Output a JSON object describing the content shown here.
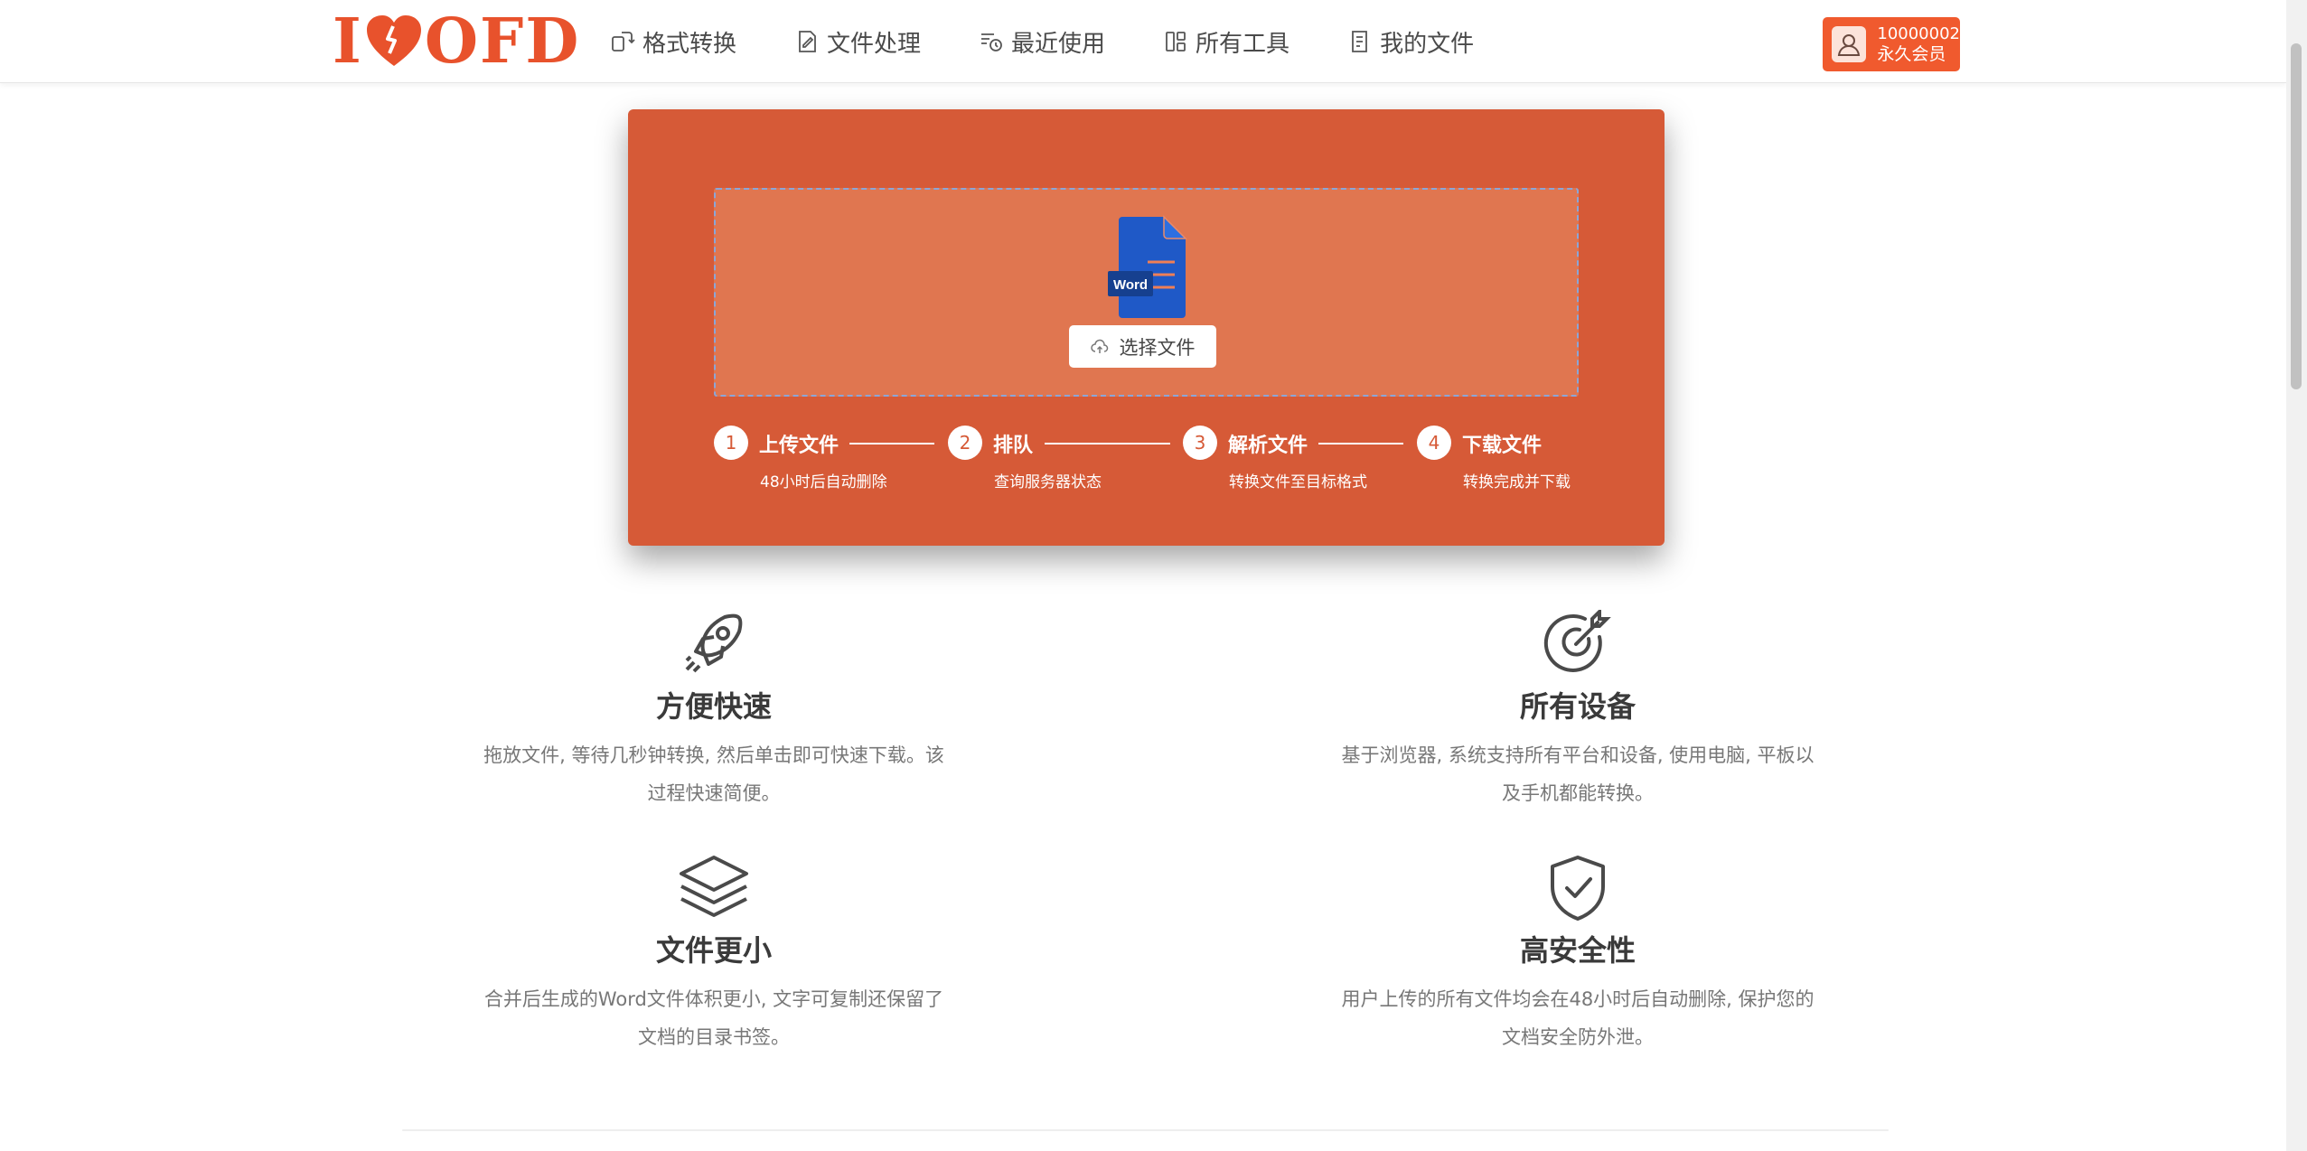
{
  "brand": {
    "logo_left": "I",
    "logo_right": "OFD",
    "accent": "#e8522c"
  },
  "nav": {
    "items": [
      {
        "label": "格式转换",
        "icon": "convert-icon"
      },
      {
        "label": "文件处理",
        "icon": "file-edit-icon"
      },
      {
        "label": "最近使用",
        "icon": "recent-icon"
      },
      {
        "label": "所有工具",
        "icon": "grid-icon"
      },
      {
        "label": "我的文件",
        "icon": "my-files-icon"
      }
    ]
  },
  "user": {
    "id": "10000002",
    "level": "永久会员"
  },
  "upload": {
    "file_type_label": "Word",
    "button_label": "选择文件",
    "steps": [
      {
        "num": "1",
        "title": "上传文件",
        "desc": "48小时后自动删除"
      },
      {
        "num": "2",
        "title": "排队",
        "desc": "查询服务器状态"
      },
      {
        "num": "3",
        "title": "解析文件",
        "desc": "转换文件至目标格式"
      },
      {
        "num": "4",
        "title": "下载文件",
        "desc": "转换完成并下载"
      }
    ]
  },
  "features": [
    {
      "title": "方便快速",
      "desc_line1": "拖放文件, 等待几秒钟转换, 然后单击即可快速下载。该",
      "desc_line2": "过程快速简便。",
      "icon": "rocket-icon"
    },
    {
      "title": "所有设备",
      "desc_line1": "基于浏览器, 系统支持所有平台和设备, 使用电脑, 平板以",
      "desc_line2": "及手机都能转换。",
      "icon": "target-icon"
    },
    {
      "title": "文件更小",
      "desc_line1": "合并后生成的Word文件体积更小, 文字可复制还保留了",
      "desc_line2": "文档的目录书签。",
      "icon": "layers-icon"
    },
    {
      "title": "高安全性",
      "desc_line1": "用户上传的所有文件均会在48小时后自动删除, 保护您的",
      "desc_line2": "文档安全防外泄。",
      "icon": "shield-check-icon"
    }
  ]
}
